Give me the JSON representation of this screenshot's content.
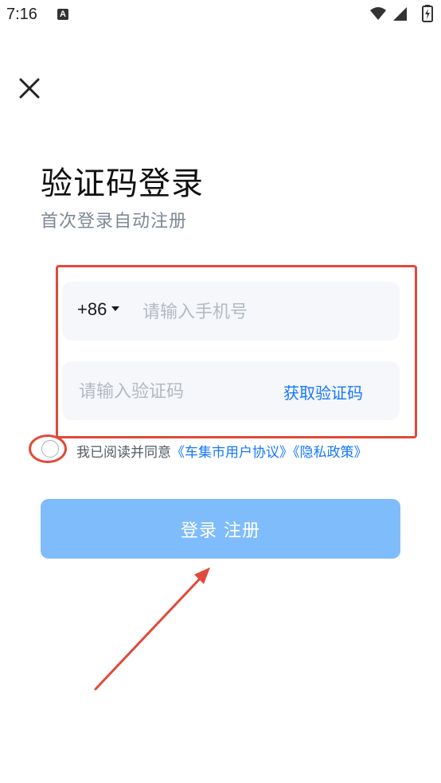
{
  "status_bar": {
    "time": "7:16",
    "notification_icon": "a-notification-icon"
  },
  "login": {
    "title": "验证码登录",
    "subtitle": "首次登录自动注册",
    "country_code": "+86",
    "phone_placeholder": "请输入手机号",
    "code_placeholder": "请输入验证码",
    "get_code_label": "获取验证码",
    "agreement_prefix": "我已阅读并同意",
    "user_agreement": "《车集市用户协议》",
    "privacy_policy": "《隐私政策》",
    "submit_label": "登录 注册"
  },
  "colors": {
    "accent": "#1677ff",
    "button_disabled": "#7fbcfb",
    "annotation": "#e04a3a",
    "field_bg": "#f5f7fa"
  }
}
